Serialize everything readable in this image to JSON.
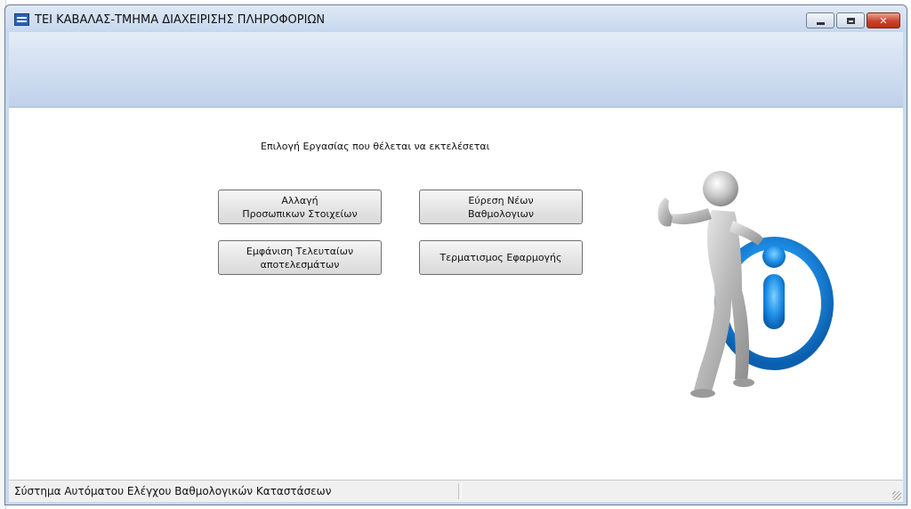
{
  "window": {
    "title": "ΤΕΙ ΚΑΒΑΛΑΣ-ΤΜΗΜΑ ΔΙΑΧΕΙΡΙΣΗΣ ΠΛΗΡΟΦΟΡΙΩΝ",
    "controls": {
      "minimize": "minimize",
      "maximize": "maximize",
      "close": "close"
    }
  },
  "main": {
    "prompt": "Επιλογή Εργασίας που θέλεται να εκτελέσεται",
    "buttons": {
      "change_personal": "Αλλαγή\nΠροσωπικων Στοιχείων",
      "find_new_grades": "Εύρεση Νέων\nΒαθμολογιων",
      "show_latest_results": "Εμφάνιση Τελευταίων\nαποτελεσμάτων",
      "exit_app": "Τερματισμος Εφαρμογής"
    },
    "illustration": "info-figure-icon"
  },
  "statusbar": {
    "text": "Σύστημα Αυτόματου Ελέγχου Βαθμολογικών Καταστάσεων"
  }
}
